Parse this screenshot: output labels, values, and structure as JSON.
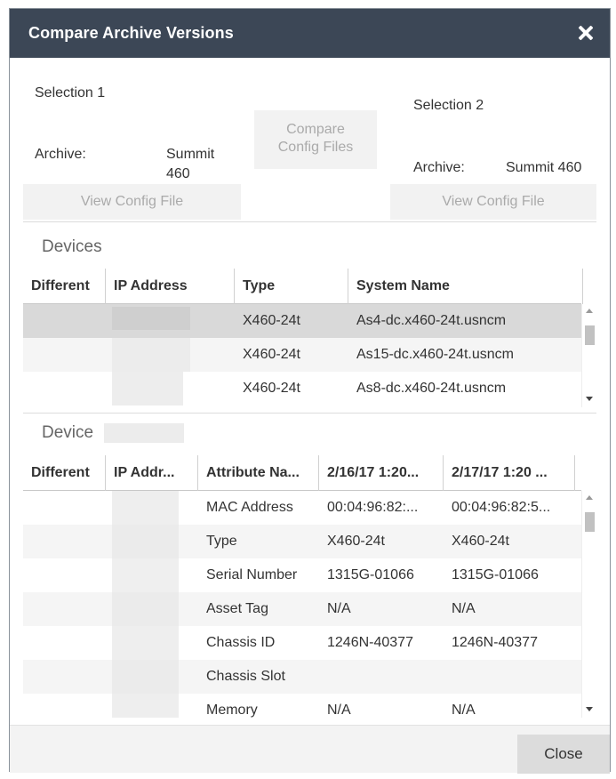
{
  "dialog": {
    "title": "Compare Archive Versions",
    "close_label": "Close"
  },
  "selection1": {
    "heading": "Selection 1",
    "archive_label": "Archive:",
    "archive_value_line1": "Summit",
    "archive_value_line2": "460",
    "view_button": "View Config File"
  },
  "selection2": {
    "heading": "Selection 2",
    "archive_label": "Archive:",
    "archive_value": "Summit 460",
    "view_button": "View Config File"
  },
  "compare_button": {
    "line1": "Compare",
    "line2": "Config Files"
  },
  "devices": {
    "title": "Devices",
    "columns": [
      "Different",
      "IP Address",
      "Type",
      "System Name"
    ],
    "rows": [
      {
        "different": "",
        "ip": "",
        "type": "X460-24t",
        "system_name": "As4-dc.x460-24t.usncm"
      },
      {
        "different": "",
        "ip": "",
        "type": "X460-24t",
        "system_name": "As15-dc.x460-24t.usncm"
      },
      {
        "different": "",
        "ip": "",
        "type": "X460-24t",
        "system_name": "As8-dc.x460-24t.usncm"
      }
    ]
  },
  "device_detail": {
    "title": "Device",
    "columns": [
      "Different",
      "IP Addr...",
      "Attribute Na...",
      "2/16/17 1:20...",
      "2/17/17 1:20 ..."
    ],
    "rows": [
      {
        "attribute": "MAC Address",
        "v1": "00:04:96:82:...",
        "v2": "00:04:96:82:5..."
      },
      {
        "attribute": "Type",
        "v1": "X460-24t",
        "v2": "X460-24t"
      },
      {
        "attribute": "Serial Number",
        "v1": "1315G-01066",
        "v2": "1315G-01066"
      },
      {
        "attribute": "Asset Tag",
        "v1": "N/A",
        "v2": "N/A"
      },
      {
        "attribute": "Chassis ID",
        "v1": "1246N-40377",
        "v2": "1246N-40377"
      },
      {
        "attribute": "Chassis Slot",
        "v1": "",
        "v2": ""
      },
      {
        "attribute": "Memory",
        "v1": "N/A",
        "v2": "N/A"
      }
    ]
  },
  "colors": {
    "titlebar": "#3c4756",
    "selected_row": "#d9d9d9",
    "alt_row": "#f5f5f5"
  }
}
